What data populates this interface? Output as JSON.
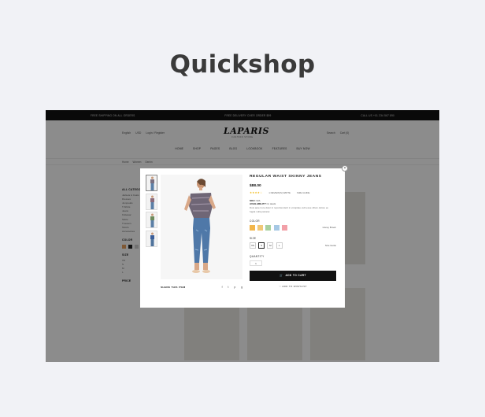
{
  "page": {
    "heading": "Quickshop"
  },
  "store": {
    "topbar": [
      "FREE SHIPPING ON ALL ORDERS",
      "FREE DELIVERY OVER ORDER $99",
      "CALL US +01 234 567 890"
    ],
    "header_left": [
      "English",
      "USD",
      "Login / Register"
    ],
    "logo": "LAPARIS",
    "logo_sub": "FASHION STORE",
    "header_right": [
      "Search",
      "Cart (0)"
    ],
    "nav": [
      "HOME",
      "SHOP",
      "PAGES",
      "BLOG",
      "LOOKBOOK",
      "FEATURES",
      "BUY NOW"
    ],
    "breadcrumb": [
      "Home",
      "Women",
      "Denim"
    ],
    "sidebar": {
      "categories_title": "ALL CATEGORIES",
      "categories": [
        "Jackets & Coats",
        "Dresses",
        "Jumpsuits",
        "T-Shirts",
        "Jeans",
        "Knitwear",
        "Shirts",
        "Trousers",
        "Shorts",
        "Accessories"
      ],
      "color_title": "COLOR",
      "size_title": "SIZE",
      "size_items": [
        "XS",
        "S",
        "M",
        "L"
      ],
      "price_title": "PRICE"
    }
  },
  "quickshop": {
    "close_icon": "×",
    "product_title": "REGULAR WAIST SKINNY JEANS",
    "price": "$88.00",
    "stars": "★★★★☆",
    "reviews_link": "1 REVIEW(S) WRITE",
    "size_chart_link": "SIZE GUIDE",
    "sku_label": "SKU:",
    "sku": "N/A",
    "availability_label": "AVAILABILITY:",
    "availability": "In stock",
    "description": "Duis aute irure dolor in reprehenderit in voluptate velit esse cillum dolore eu fugiat nulla pariatur.",
    "color_label": "COLOR",
    "colors": [
      "#f2b64b",
      "#f0c878",
      "#a8d0a0",
      "#a6c8e4",
      "#f2a0a8"
    ],
    "selected_color_name": "Honey Brown",
    "size_label": "SIZE",
    "sizes": [
      "XS",
      "S",
      "M",
      "L"
    ],
    "selected_size": "S",
    "size_guide": "Size Guide",
    "quantity_label": "QUANTITY",
    "quantity": "1",
    "add_to_cart": "ADD TO CART",
    "add_to_wishlist": "ADD TO WISHLIST",
    "share_label": "SHARE THIS ITEM",
    "share_icons": [
      "f",
      "t",
      "p",
      "g"
    ]
  }
}
